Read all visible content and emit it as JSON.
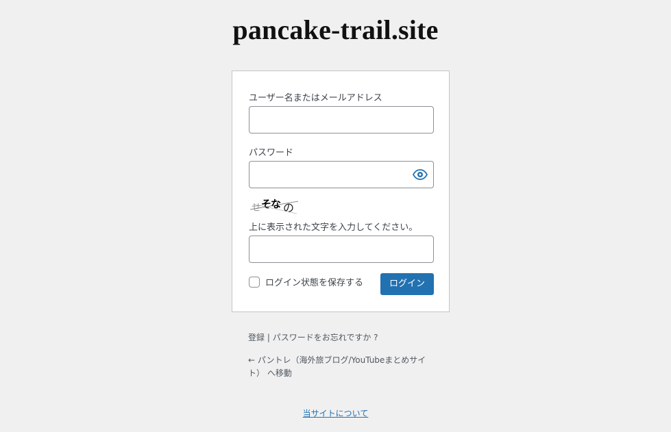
{
  "site": {
    "title": "pancake-trail.site"
  },
  "form": {
    "username_label": "ユーザー名またはメールアドレス",
    "username_value": "",
    "password_label": "パスワード",
    "password_value": "",
    "captcha_text": "せそなの",
    "captcha_label": "上に表示された文字を入力してください。",
    "captcha_value": "",
    "remember_label": "ログイン状態を保存する",
    "login_button": "ログイン"
  },
  "nav": {
    "register": "登録",
    "separator": " | ",
    "lost_password": "パスワードをお忘れですか ?"
  },
  "back_link": "← パントレ（海外旅ブログ/YouTubeまとめサイト） へ移動",
  "footer_link": "当サイトについて",
  "colors": {
    "accent": "#2271b1",
    "background": "#f0f0f1"
  }
}
